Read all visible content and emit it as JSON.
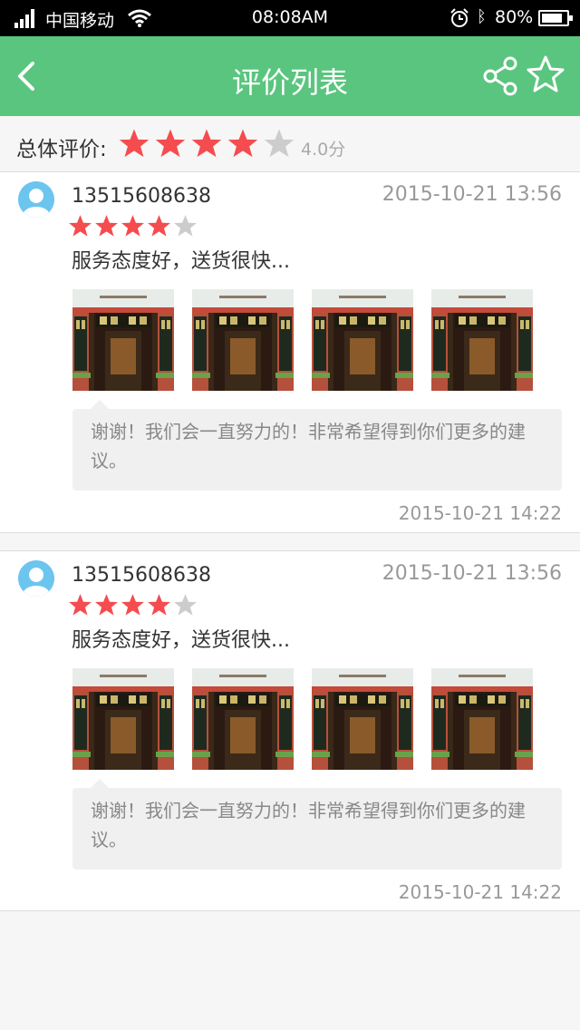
{
  "status_bar": {
    "carrier": "中国移动",
    "time": "08:08AM",
    "battery": "80%"
  },
  "nav": {
    "title": "评价列表",
    "icons": [
      "back-arrow-icon",
      "share-icon",
      "star-outline-icon"
    ]
  },
  "overall": {
    "label": "总体评价:",
    "rating": 4,
    "max": 5,
    "score_text": "4.0分"
  },
  "colors": {
    "nav_green": "#5ac57e",
    "star_red": "#f54c4f",
    "star_gray": "#cccccc"
  },
  "reviews": [
    {
      "user": "13515608638",
      "time": "2015-10-21 13:56",
      "rating": 4,
      "text": "服务态度好，送货很快...",
      "photo_count": 4,
      "reply": "谢谢！我们会一直努力的！非常希望得到你们更多的建议。",
      "reply_time": "2015-10-21 14:22"
    },
    {
      "user": "13515608638",
      "time": "2015-10-21 13:56",
      "rating": 4,
      "text": "服务态度好，送货很快...",
      "photo_count": 4,
      "reply": "谢谢！我们会一直努力的！非常希望得到你们更多的建议。",
      "reply_time": "2015-10-21 14:22"
    }
  ]
}
